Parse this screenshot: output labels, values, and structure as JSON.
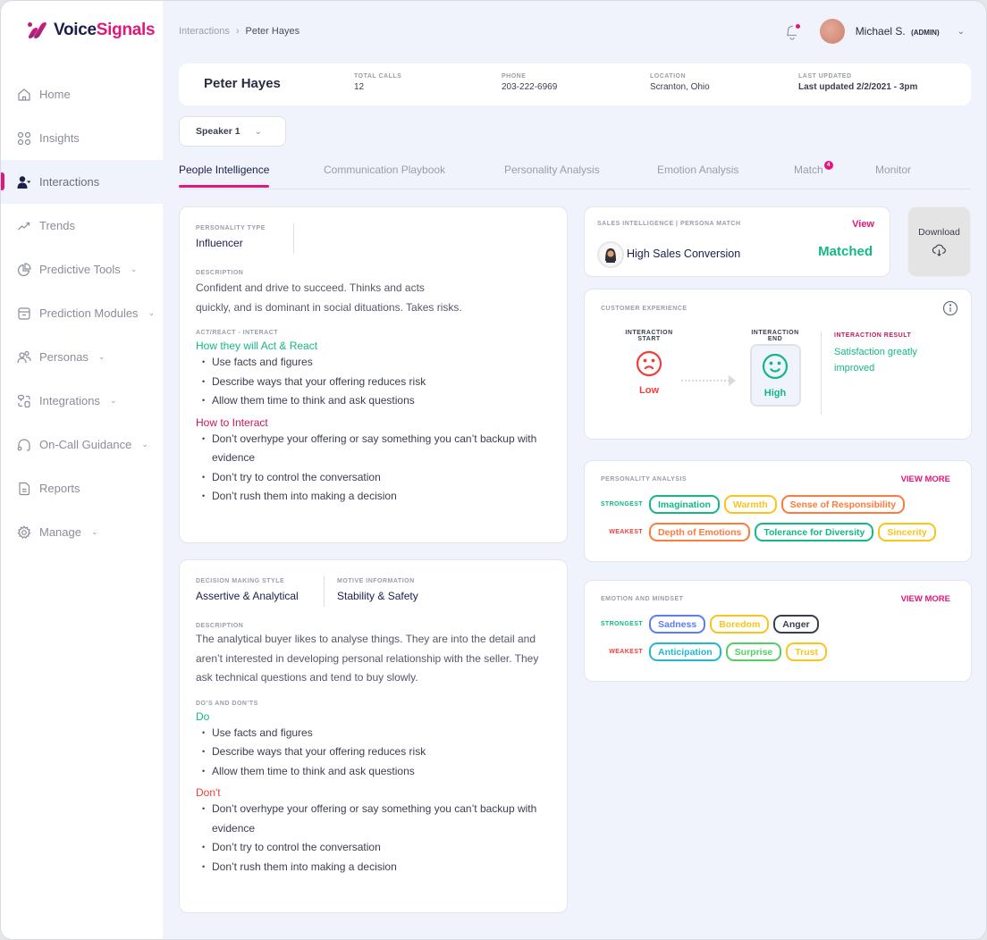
{
  "app": {
    "brand_part1": "Voice",
    "brand_part2": "Signals",
    "brand_color": "#e0177c"
  },
  "sidebar": {
    "items": [
      {
        "label": "Home",
        "icon": "home-icon",
        "has_chevron": false,
        "active": false
      },
      {
        "label": "Insights",
        "icon": "grid-icon",
        "has_chevron": false,
        "active": false
      },
      {
        "label": "Interactions",
        "icon": "user-chat-icon",
        "has_chevron": false,
        "active": true
      },
      {
        "label": "Trends",
        "icon": "trend-icon",
        "has_chevron": false,
        "active": false
      },
      {
        "label": "Predictive Tools",
        "icon": "pie-chart-icon",
        "has_chevron": true,
        "active": false
      },
      {
        "label": "Prediction Modules",
        "icon": "archive-icon",
        "has_chevron": true,
        "active": false
      },
      {
        "label": "Personas",
        "icon": "users-icon",
        "has_chevron": true,
        "active": false
      },
      {
        "label": "Integrations",
        "icon": "integrations-icon",
        "has_chevron": true,
        "active": false
      },
      {
        "label": "On-Call Guidance",
        "icon": "headphones-icon",
        "has_chevron": true,
        "active": false
      },
      {
        "label": "Reports",
        "icon": "document-icon",
        "has_chevron": false,
        "active": false
      },
      {
        "label": "Manage",
        "icon": "gear-icon",
        "has_chevron": true,
        "active": false
      }
    ],
    "chevron": "⌄"
  },
  "breadcrumb": {
    "parent": "Interactions",
    "separator": "›",
    "current": "Peter Hayes"
  },
  "user": {
    "name": "Michael S.",
    "role": "(ADMIN)",
    "chevron": "⌄"
  },
  "header": {
    "name": "Peter Hayes",
    "fields": [
      {
        "label": "TOTAL CALLS",
        "value": "12"
      },
      {
        "label": "PHONE",
        "value": "203-222-6969"
      },
      {
        "label": "LOCATION",
        "value": "Scranton, Ohio"
      },
      {
        "label": "LAST UPDATED",
        "value": "Last updated 2/2/2021 - 3pm"
      }
    ]
  },
  "speaker_select": {
    "value": "Speaker 1",
    "chevron": "⌄"
  },
  "tabs": [
    {
      "label": "People Intelligence",
      "active": true
    },
    {
      "label": "Communication Playbook",
      "active": false
    },
    {
      "label": "Personality Analysis",
      "active": false
    },
    {
      "label": "Emotion Analysis",
      "active": false
    },
    {
      "label": "Match",
      "active": false,
      "badge": "4"
    },
    {
      "label": "Monitor",
      "active": false
    }
  ],
  "personality_card": {
    "type_label": "PERSONALITY TYPE",
    "type_value": "Influencer",
    "description_label": "DESCRIPTION",
    "description_line1": "Confident and drive to succeed.  Thinks and acts",
    "description_line2": "quickly, and is dominant in social dituations.  Takes risks.",
    "act_label": "ACT/REACT - INTERACT",
    "act_heading": "How they will Act & React",
    "act_items": [
      "Use facts and figures",
      "Describe ways that your offering reduces risk",
      "Allow them time to think and ask questions"
    ],
    "interact_heading": "How to Interact",
    "interact_items": [
      "Don’t overhype your offering or say something you can’t backup with evidence",
      "Don’t try to control the conversation",
      "Don’t rush them into making a decision"
    ]
  },
  "decision_card": {
    "style_label": "DECISION MAKING STYLE",
    "style_value": "Assertive & Analytical",
    "motive_label": "MOTIVE INFORMATION",
    "motive_value": "Stability & Safety",
    "description_label": "DESCRIPTION",
    "description": "The analytical buyer likes to analyse things. They are into the detail and aren’t interested in developing personal relationship with the seller. They ask technical questions and tend to buy slowly.",
    "dos_label": "DO’S AND DON’TS",
    "do_heading": "Do",
    "do_items": [
      "Use facts and figures",
      "Describe ways that your offering reduces risk",
      "Allow them time to think and ask questions"
    ],
    "dont_heading": "Don't",
    "dont_items": [
      "Don’t overhype your offering or say something you can’t backup with evidence",
      "Don’t try to control the conversation",
      "Don’t rush them into making a decision"
    ]
  },
  "sales_card": {
    "label": "SALES INTELLIGENCE | PERSONA MATCH",
    "view": "View",
    "persona": "High Sales Conversion",
    "status": "Matched"
  },
  "download": {
    "label": "Download"
  },
  "customer_experience": {
    "label": "CUSTOMER EXPERIENCE",
    "start_label_1": "INTERACTION",
    "start_label_2": "START",
    "start_value": "Low",
    "end_label_1": "INTERACTION",
    "end_label_2": "END",
    "end_value": "High",
    "result_label": "INTERACTION RESULT",
    "result_line1": "Satisfaction greatly",
    "result_line2": "improved"
  },
  "personality_analysis": {
    "label": "PERSONALITY ANALYSIS",
    "view_more": "VIEW MORE",
    "strongest_label": "STRONGEST",
    "weakest_label": "WEAKEST",
    "strongest": [
      {
        "label": "Imagination",
        "color": "#12b886"
      },
      {
        "label": "Warmth",
        "color": "#fcc419"
      },
      {
        "label": "Sense of Responsibility",
        "color": "#ff7a3d"
      }
    ],
    "weakest": [
      {
        "label": "Depth of Emotions",
        "color": "#ff7a3d"
      },
      {
        "label": "Tolerance for Diversity",
        "color": "#12b886"
      },
      {
        "label": "Sincerity",
        "color": "#fcc419"
      }
    ]
  },
  "emotion_mindset": {
    "label": "EMOTION AND MINDSET",
    "view_more": "VIEW MORE",
    "strongest_label": "STRONGEST",
    "weakest_label": "WEAKEST",
    "strongest": [
      {
        "label": "Sadness",
        "color": "#5c7cfa"
      },
      {
        "label": "Boredom",
        "color": "#fcc419"
      },
      {
        "label": "Anger",
        "color": "#3b3e4e"
      }
    ],
    "weakest": [
      {
        "label": "Anticipation",
        "color": "#22b8cf"
      },
      {
        "label": "Surprise",
        "color": "#51cf66"
      },
      {
        "label": "Trust",
        "color": "#fcc419"
      }
    ]
  }
}
